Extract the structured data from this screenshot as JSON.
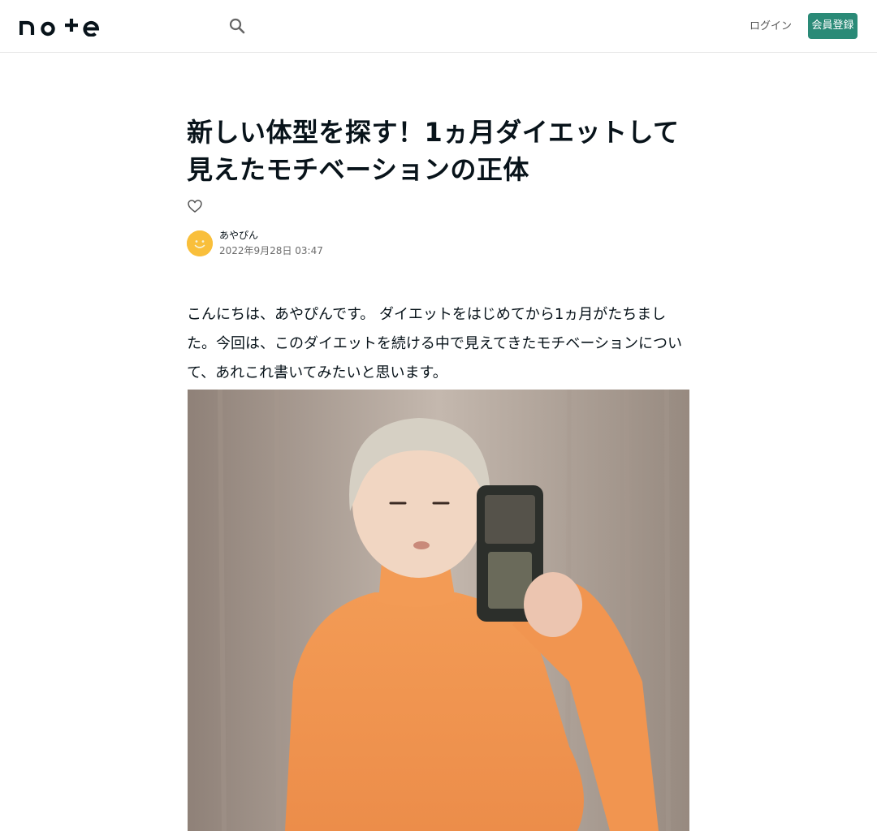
{
  "header": {
    "logo_text": "note",
    "search_icon": "search-icon",
    "login_label": "ログイン",
    "signup_label": "会員登録"
  },
  "article": {
    "title": "新しい体型を探す！1ヵ月ダイエットして見えたモチベーションの正体",
    "like_icon": "heart-outline-icon",
    "author_name": "あやぴん",
    "post_date": "2022年9月28日 03:47",
    "lead_text": "こんにちは、あやぴんです。 ダイエットをはじめてから1ヵ月がたちました。今回は、このダイエットを続ける中で見えてきたモチベーションについて、あれこれ書いてみたいと思います。",
    "photo_alt": "photo"
  },
  "colors": {
    "accent": "#2a8a77",
    "avatar": "#f9bf3b",
    "text": "#08131a",
    "border": "#e6e6e6"
  }
}
